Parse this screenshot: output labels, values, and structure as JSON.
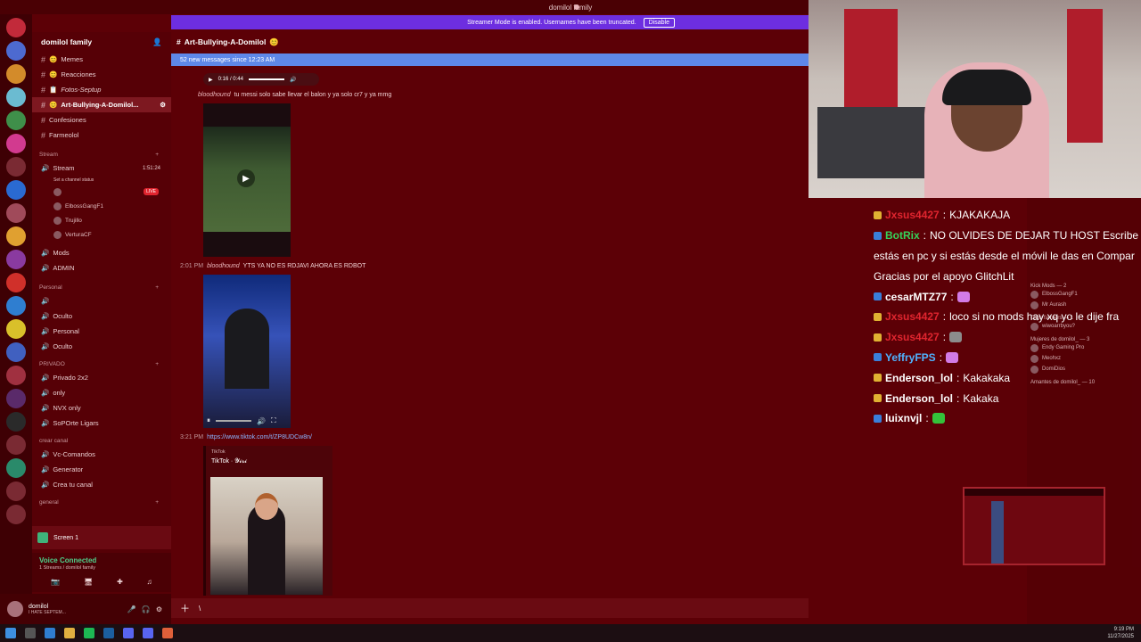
{
  "window": {
    "title": "domilol family"
  },
  "banner": {
    "text": "Streamer Mode is enabled. Usernames have been truncated.",
    "disable_label": "Disable"
  },
  "server": {
    "name": "domilol family"
  },
  "channels": [
    {
      "label": "Memes",
      "icon": "😊"
    },
    {
      "label": "Reacciones",
      "icon": "😊"
    },
    {
      "label": "Fotos-Septup",
      "icon": "📋"
    },
    {
      "label": "Art-Bullying-A-Domilol...",
      "icon": "😊",
      "active": true
    },
    {
      "label": "Confesiones",
      "icon": ""
    },
    {
      "label": "Farmeolol",
      "icon": ""
    }
  ],
  "stream_category": "Stream",
  "stream_channel": {
    "label": "Stream",
    "time": "1:51:24",
    "status": "Set a channel status",
    "live": "LIVE"
  },
  "stream_users": [
    "ElbossGangF1",
    "Trujillo",
    "VerturaCF"
  ],
  "other_channels": [
    {
      "label": "Mods"
    },
    {
      "label": "ADMIN"
    }
  ],
  "personal_category": "Personal",
  "personal_channels": [
    "Oculto",
    "Personal",
    "Oculto"
  ],
  "privado_category": "PRIVADO",
  "privado_channels": [
    "Privado 2x2",
    "only",
    "NVX only",
    "SoPOrte Ligars"
  ],
  "crear_category": "crear canal",
  "crear_channels": [
    "Vc-Comandos",
    "Generator",
    "Crea tu canal"
  ],
  "general_category": "general",
  "screen": {
    "title": "Screen 1"
  },
  "voice": {
    "title": "Voice Connected",
    "sub": "1 Streams / domilol family"
  },
  "user": {
    "name": "domilol",
    "status": "I HATE SEPTEM..."
  },
  "chat": {
    "channel_title": "Art-Bullying-A-Domilol",
    "new_messages": "52 new messages since 12:23 AM",
    "audio_time": "0:16 / 0:44",
    "msg1_user": "bloodhound",
    "msg1_text": "tu messi solo sabe llevar el balon y ya solo cr7 y ya mmg",
    "msg2_time": "2:01 PM",
    "msg2_user": "bloodhound",
    "msg2_text": "YTS YA NO ES RDJAVI AHORA ES RDBOT",
    "msg3_time": "3:21 PM",
    "msg3_link": "https://www.tiktok.com/t/ZP8UDCw8n/",
    "embed_provider": "TikTok",
    "embed_title": "TikTok · 𝓨𝓲𝓻𝓲",
    "composer_text": "\\"
  },
  "stream_chat": [
    {
      "name": "Jxsus4427",
      "text": "KJAKAKAJA",
      "color": "#e0252f",
      "badge": "b1"
    },
    {
      "name": "BotRix",
      "text": "NO OLVIDES DE DEJAR TU HOST Escribe",
      "color": "#35d35b",
      "badge": "b2"
    },
    {
      "name": "",
      "text": "estás en pc y si estás desde el móvil le das en Compar",
      "color": "#fff",
      "badge": ""
    },
    {
      "name": "",
      "text": "Gracias por el apoyo GlitchLit",
      "color": "#fff",
      "badge": ""
    },
    {
      "name": "cesarMTZ77",
      "text": "",
      "color": "#ffffff",
      "badge": "b2",
      "emote": "#d27be6"
    },
    {
      "name": "Jxsus4427",
      "text": "loco si no mods hay xq yo le dije fra",
      "color": "#e0252f",
      "badge": "b1"
    },
    {
      "name": "Jxsus4427",
      "text": "",
      "color": "#e0252f",
      "badge": "b1",
      "emote": "#8c8c8c"
    },
    {
      "name": "YeffryFPS",
      "text": "",
      "color": "#4fb3ff",
      "badge": "b2",
      "emote": "#d27be6"
    },
    {
      "name": "Enderson_lol",
      "text": "Kakakaka",
      "color": "#ffffff",
      "badge": "b1"
    },
    {
      "name": "Enderson_lol",
      "text": "Kakaka",
      "color": "#ffffff",
      "badge": "b1"
    },
    {
      "name": "luixnvjl",
      "text": "",
      "color": "#ffffff",
      "badge": "b2",
      "emote": "#34c23a"
    }
  ],
  "members": {
    "kick_mods": "Kick Mods — 2",
    "kick_mods_list": [
      "ElbossGangF1",
      "Mr Aurash"
    ],
    "clips": "Clips farmers — 1",
    "clips_list": [
      "wiwoarrbyou?"
    ],
    "mujeres": "Mujeres de domilol_ — 3",
    "mujeres_list": [
      "Endy Gaming Pro",
      "Meohxz",
      "DomiDios"
    ],
    "amantes": "Amantes de domilol_ — 10"
  },
  "tray": {
    "time": "9:19 PM",
    "date": "11/27/2025"
  }
}
